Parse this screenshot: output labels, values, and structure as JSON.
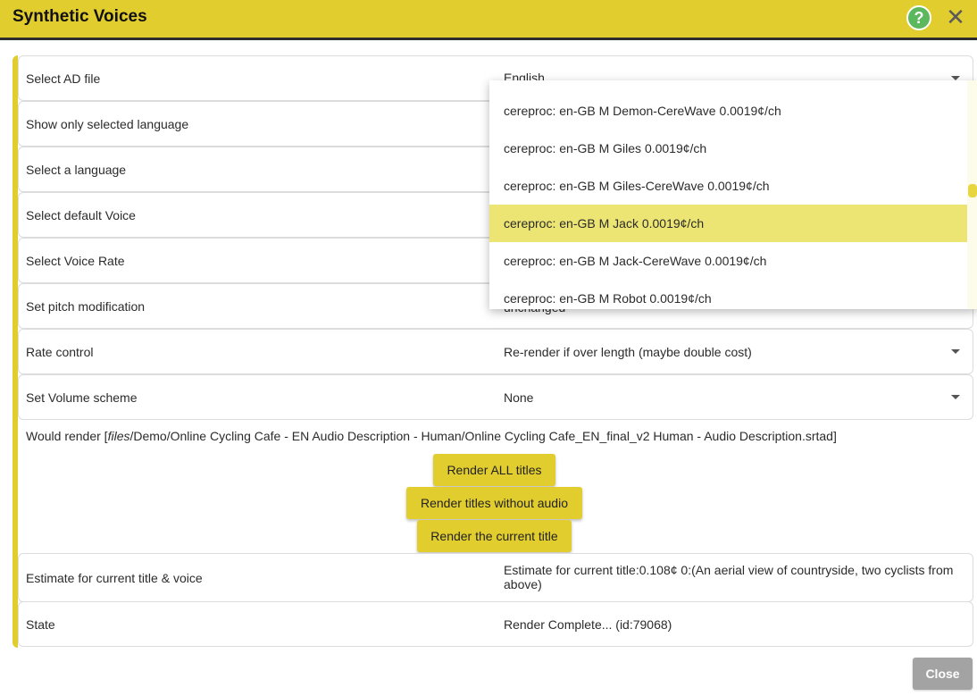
{
  "window": {
    "title": "Synthetic Voices",
    "help_glyph": "?",
    "close_glyph": "✕",
    "accent_color": "#e2cd2e"
  },
  "rows": {
    "ad_file": {
      "label": "Select AD file",
      "value": "English"
    },
    "show_language": {
      "label": "Show only selected language"
    },
    "language": {
      "label": "Select a language"
    },
    "default_voice": {
      "label": "Select default Voice"
    },
    "voice_rate": {
      "label": "Select Voice Rate"
    },
    "pitch": {
      "label": "Set pitch modification",
      "value": "unchanged"
    },
    "rate_control": {
      "label": "Rate control",
      "value": "Re-render if over length (maybe double cost)"
    },
    "volume": {
      "label": "Set Volume scheme",
      "value": "None"
    },
    "estimate": {
      "label": "Estimate for current title & voice",
      "value": "Estimate for current title:0.108¢ 0:(An aerial view of countryside, two cyclists from above)"
    },
    "state": {
      "label": "State",
      "value": "Render Complete... (id:79068)"
    }
  },
  "render": {
    "prefix": "Would render [",
    "dir": "files",
    "sep": "/",
    "path": "Demo/Online Cycling Cafe - EN Audio Description - Human/Online Cycling Cafe_EN_final_v2 Human - Audio Description.srtad",
    "suffix": "]"
  },
  "buttons": {
    "render_all": "Render ALL titles",
    "render_no_audio": "Render titles without audio",
    "render_current": "Render the current title",
    "close": "Close"
  },
  "voice_dropdown": {
    "selected_index": 3,
    "items": [
      "cereproc: en-GB M Demon-CereWave 0.0019¢/ch",
      "cereproc: en-GB M Giles 0.0019¢/ch",
      "cereproc: en-GB M Giles-CereWave 0.0019¢/ch",
      "cereproc: en-GB M Jack 0.0019¢/ch",
      "cereproc: en-GB M Jack-CereWave 0.0019¢/ch",
      "cereproc: en-GB M Robot 0.0019¢/ch"
    ]
  }
}
